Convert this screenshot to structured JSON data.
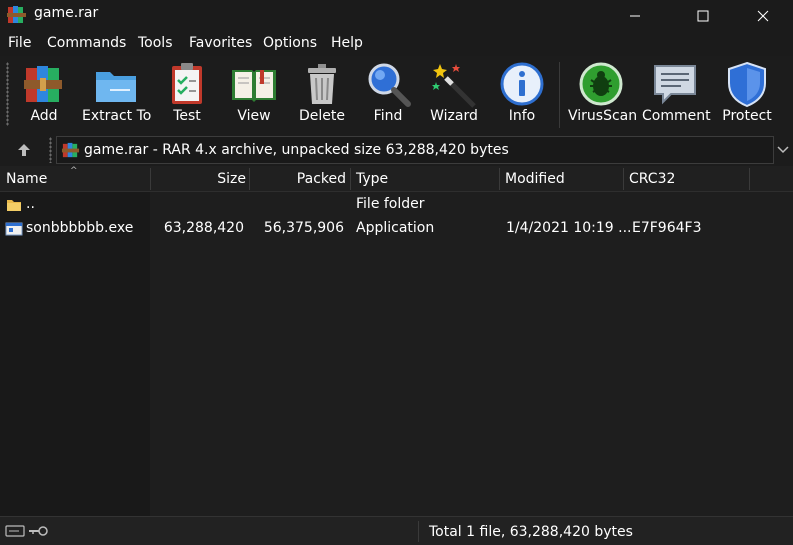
{
  "window": {
    "title": "game.rar",
    "app_icon": "winrar-books-icon"
  },
  "menu": [
    {
      "label": "File"
    },
    {
      "label": "Commands"
    },
    {
      "label": "Tools"
    },
    {
      "label": "Favorites"
    },
    {
      "label": "Options"
    },
    {
      "label": "Help"
    }
  ],
  "toolbar": [
    {
      "label": "Add",
      "icon": "winrar-books-icon"
    },
    {
      "label": "Extract To",
      "icon": "folder-icon"
    },
    {
      "label": "Test",
      "icon": "clipboard-check-icon"
    },
    {
      "label": "View",
      "icon": "open-book-icon"
    },
    {
      "label": "Delete",
      "icon": "trash-icon"
    },
    {
      "label": "Find",
      "icon": "magnifier-icon"
    },
    {
      "label": "Wizard",
      "icon": "magic-wand-icon"
    },
    {
      "label": "Info",
      "icon": "info-icon"
    },
    {
      "label": "VirusScan",
      "icon": "bug-scan-icon"
    },
    {
      "label": "Comment",
      "icon": "speech-bubble-icon"
    },
    {
      "label": "Protect",
      "icon": "shield-icon"
    }
  ],
  "address": {
    "text": "game.rar - RAR 4.x archive, unpacked size 63,288,420 bytes"
  },
  "columns": [
    {
      "label": "Name"
    },
    {
      "label": "Size"
    },
    {
      "label": "Packed"
    },
    {
      "label": "Type"
    },
    {
      "label": "Modified"
    },
    {
      "label": "CRC32"
    }
  ],
  "rows": [
    {
      "name": "..",
      "size": "",
      "packed": "",
      "type": "File folder",
      "modified": "",
      "crc": "",
      "icon": "folder-icon"
    },
    {
      "name": "sonbbbbbb.exe",
      "size": "63,288,420",
      "packed": "56,375,906",
      "type": "Application",
      "modified": "1/4/2021 10:19 ...",
      "crc": "E7F964F3",
      "icon": "exe-file-icon"
    }
  ],
  "status": {
    "text": "Total 1 file, 63,288,420 bytes"
  }
}
